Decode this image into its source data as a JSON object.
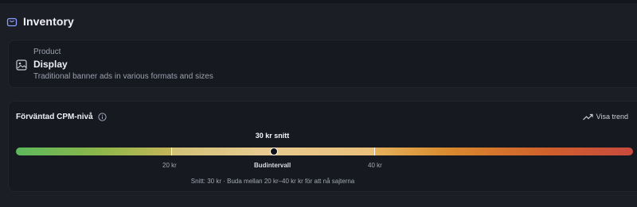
{
  "header": {
    "title": "Inventory",
    "icon": "shopping-bag-icon",
    "accent": "#8c9dff"
  },
  "product": {
    "kicker": "Product",
    "name": "Display",
    "description": "Traditional banner ads in various formats and sizes",
    "icon": "image-icon"
  },
  "cpm": {
    "title": "Förväntad CPM-nivå",
    "info_icon": "info-icon",
    "trend_label": "Visa trend",
    "trend_icon": "trend-up-icon",
    "average_label": "30 kr snitt",
    "bid_interval": {
      "min": 20,
      "max": 40,
      "average": 30
    },
    "scale": {
      "min": 0,
      "max": 90
    },
    "ticks": {
      "low": "20 kr",
      "mid": "Budintervall",
      "high": "40 kr"
    },
    "note": "Snitt: 30 kr · Buda mellan 20 kr–40 kr kr för att nå sajterna",
    "gradient_colors": [
      "#5cb85c",
      "#e3c07a",
      "#d98a2e",
      "#c84a3e"
    ]
  }
}
